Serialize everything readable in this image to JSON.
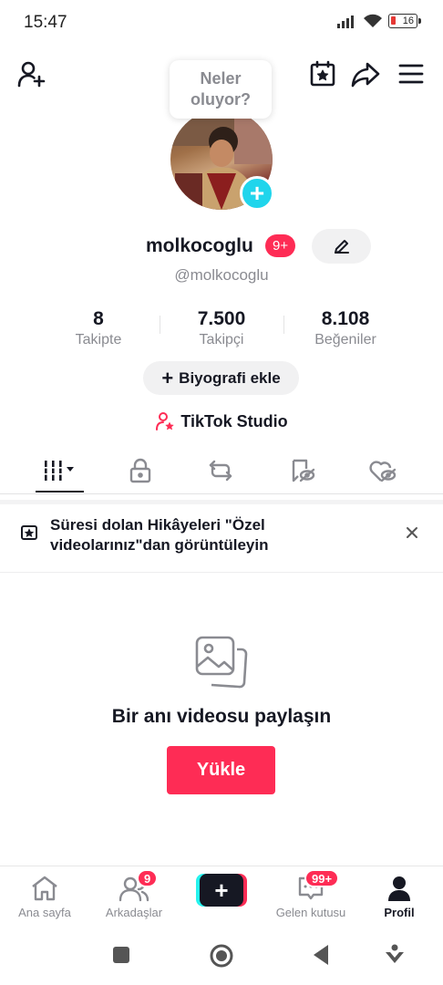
{
  "status_bar": {
    "time": "15:47",
    "battery": "16"
  },
  "tooltip": {
    "line1": "Neler",
    "line2": "oluyor?"
  },
  "profile": {
    "username": "molkocoglu",
    "notification_badge": "9+",
    "handle": "@molkocoglu"
  },
  "stats": [
    {
      "value": "8",
      "label": "Takipte"
    },
    {
      "value": "7.500",
      "label": "Takipçi"
    },
    {
      "value": "8.108",
      "label": "Beğeniler"
    }
  ],
  "bio_button": {
    "plus": "+",
    "label": "Biyografi ekle"
  },
  "studio_link": {
    "label": "TikTok Studio"
  },
  "banner": {
    "text": "Süresi dolan Hikâyeleri \"Özel videolarınız\"dan görüntüleyin"
  },
  "empty_state": {
    "title": "Bir anı videosu paylaşın",
    "upload_label": "Yükle"
  },
  "bottom_nav": {
    "home": "Ana sayfa",
    "friends": "Arkadaşlar",
    "friends_badge": "9",
    "create": "+",
    "inbox": "Gelen kutusu",
    "inbox_badge": "99+",
    "profile": "Profil"
  },
  "colors": {
    "accent": "#fe2c55",
    "cyan": "#20d5ec",
    "text": "#161823",
    "muted": "#8a8b91"
  }
}
